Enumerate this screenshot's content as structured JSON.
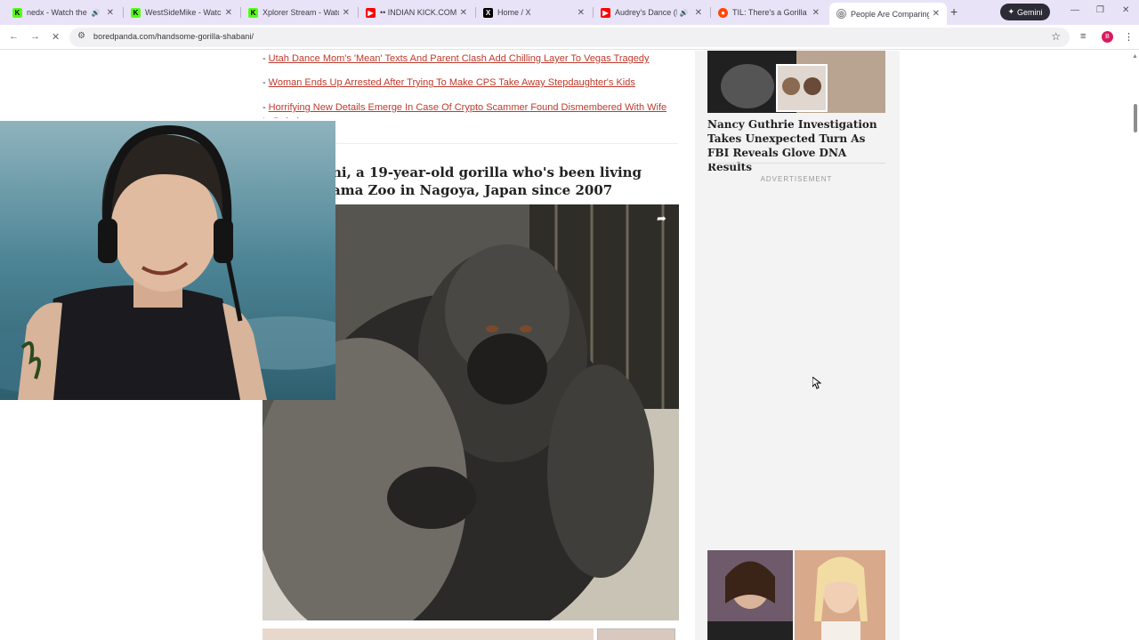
{
  "tabs": [
    {
      "title": "nedx - Watch the V",
      "favicon": "kick",
      "color": "#53fc18",
      "audio": true
    },
    {
      "title": "WestSideMike - Watch",
      "favicon": "kick",
      "color": "#53fc18",
      "audio": false
    },
    {
      "title": "Xplorer Stream - Watch",
      "favicon": "kick",
      "color": "#53fc18",
      "audio": false
    },
    {
      "title": "•• INDIAN KICK.COM",
      "favicon": "youtube",
      "color": "#ff0000",
      "audio": false
    },
    {
      "title": "Home / X",
      "favicon": "x",
      "color": "#000000",
      "audio": false
    },
    {
      "title": "Audrey's Dance (Ins",
      "favicon": "youtube",
      "color": "#ff0000",
      "audio": true
    },
    {
      "title": "TIL: There's a Gorilla in",
      "favicon": "reddit",
      "color": "#ff4500",
      "audio": false
    },
    {
      "title": "People Are Comparing",
      "favicon": "globe",
      "color": "#888888",
      "audio": false,
      "active": true
    }
  ],
  "toolbar": {
    "gemini_label": "Gemini",
    "url": "boredpanda.com/handsome-gorilla-shabani/",
    "profile_initial": "B"
  },
  "article": {
    "related_links": [
      "Utah Dance Mom's 'Mean' Texts And Parent Clash Add Chilling Layer To Vegas Tragedy",
      "Woman Ends Up Arrested After Trying To Make CPS Take Away Stepdaughter's Kids",
      "Horrifying New Details Emerge In Case Of Crypto Scammer Found Dismembered With Wife In Dubai"
    ],
    "heading_line1": "ni, a 19-year-old gorilla who's been living",
    "heading_line2": "ama Zoo in Nagoya, Japan since 2007"
  },
  "sidebar": {
    "story_title": "Nancy Guthrie Investigation Takes Unexpected Turn As FBI Reveals Glove DNA Results",
    "advertisement_label": "ADVERTISEMENT"
  },
  "colors": {
    "link": "#c0392b",
    "tabstrip": "#e9e3f8"
  }
}
